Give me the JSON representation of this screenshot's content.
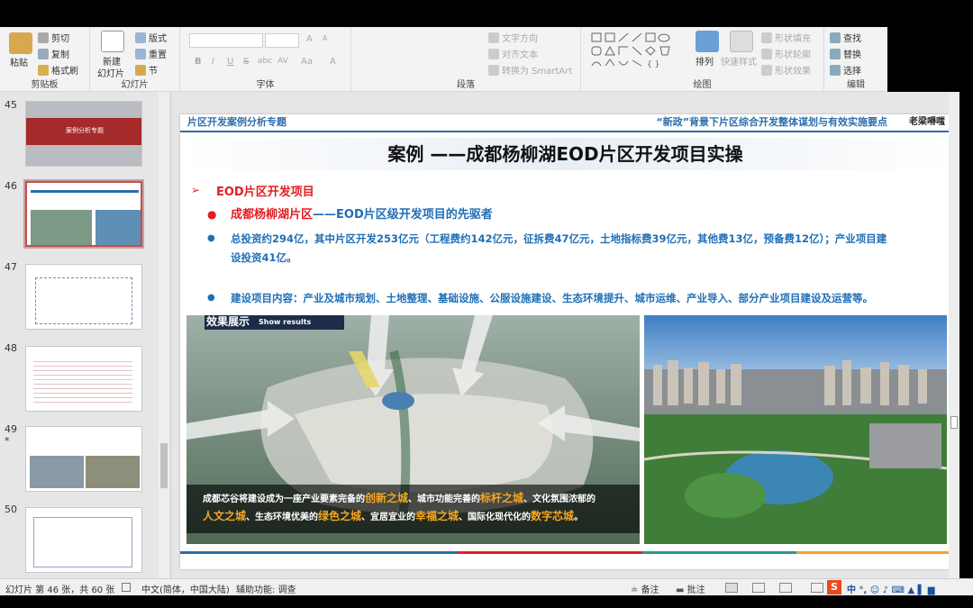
{
  "ribbon": {
    "clipboard": {
      "paste": "粘贴",
      "cut": "剪切",
      "copy": "复制",
      "format_painter": "格式刷",
      "label": "剪贴板"
    },
    "slides": {
      "new_slide_line1": "新建",
      "new_slide_line2": "幻灯片",
      "layout": "版式",
      "reset": "重置",
      "section": "节",
      "label": "幻灯片"
    },
    "font": {
      "bold": "B",
      "italic": "I",
      "underline": "U",
      "strike": "S",
      "shadow": "abc",
      "spacing": "AV",
      "case": "Aa",
      "color": "A",
      "grow": "A",
      "shrink": "A",
      "label": "字体"
    },
    "paragraph": {
      "text_direction": "文字方向",
      "align_text": "对齐文本",
      "smartart": "转换为 SmartArt",
      "label": "段落"
    },
    "drawing": {
      "arrange": "排列",
      "quick_styles": "快速样式",
      "shape_fill": "形状填充",
      "shape_outline": "形状轮廓",
      "shape_effects": "形状效果",
      "label": "绘图"
    },
    "editing": {
      "find": "查找",
      "replace": "替换",
      "select": "选择",
      "label": "编辑"
    }
  },
  "thumbnails": [
    {
      "num": "45",
      "title": "案例分析专题",
      "star": ""
    },
    {
      "num": "46",
      "title": "",
      "star": ""
    },
    {
      "num": "47",
      "title": "",
      "star": ""
    },
    {
      "num": "48",
      "title": "",
      "star": ""
    },
    {
      "num": "49",
      "title": "",
      "star": "*"
    },
    {
      "num": "50",
      "title": "",
      "star": ""
    }
  ],
  "slide": {
    "header_left": "片区开发案例分析专题",
    "header_right": "“新政”背景下片区综合开发整体谋划与有效实施要点",
    "logo": "老梁嘚嗤",
    "title": "案例 ——成都杨柳湖EOD片区开发项目实操",
    "section_marker": "➢",
    "section": "EOD片区开发项目",
    "bullet1_a": "成都杨柳湖片区",
    "bullet1_b": "——EOD片区级开发项目的先驱者",
    "bullet2_line1": "总投资约294亿，其中片区开发253亿元（工程费约142亿元，征拆费47亿元，土地指标费39亿元，其他费13亿，预备费12亿）；产业项目建",
    "bullet2_line2": "设投资41亿。",
    "bullet3": "建设项目内容：产业及城市规划、土地整理、基础设施、公服设施建设、生态环境提升、城市运维、产业导入、部分产业项目建设及运营等。",
    "effect_label_cn": "效果展示",
    "effect_label_en": "Show results",
    "caption_parts": [
      {
        "t": "成都芯谷将建设成为一座产业要素完备的",
        "hl": false
      },
      {
        "t": "创新之城",
        "hl": true
      },
      {
        "t": "、城市功能完善的",
        "hl": false
      },
      {
        "t": "标杆之城",
        "hl": true
      },
      {
        "t": "、文化氛围浓郁的",
        "hl": false
      }
    ],
    "caption_parts2": [
      {
        "t": "人文之城",
        "hl": true
      },
      {
        "t": "、生态环境优美的",
        "hl": false
      },
      {
        "t": "绿色之城",
        "hl": true
      },
      {
        "t": "、宜居宜业的",
        "hl": false
      },
      {
        "t": "幸福之城",
        "hl": true
      },
      {
        "t": "、国际化现代化的",
        "hl": false
      },
      {
        "t": "数字芯城",
        "hl": true
      },
      {
        "t": "。",
        "hl": false
      }
    ]
  },
  "status": {
    "slide_info": "幻灯片 第 46 张，共 60 张",
    "language": "中文(简体，中国大陆)",
    "accessibility": "辅助功能: 调查",
    "notes": "备注",
    "comments": "批注"
  },
  "colors": {
    "accent_red": "#c0504d",
    "title_blue": "#1f6fb6",
    "highlight_orange": "#f5a623",
    "header_blue": "#2c6eab"
  }
}
